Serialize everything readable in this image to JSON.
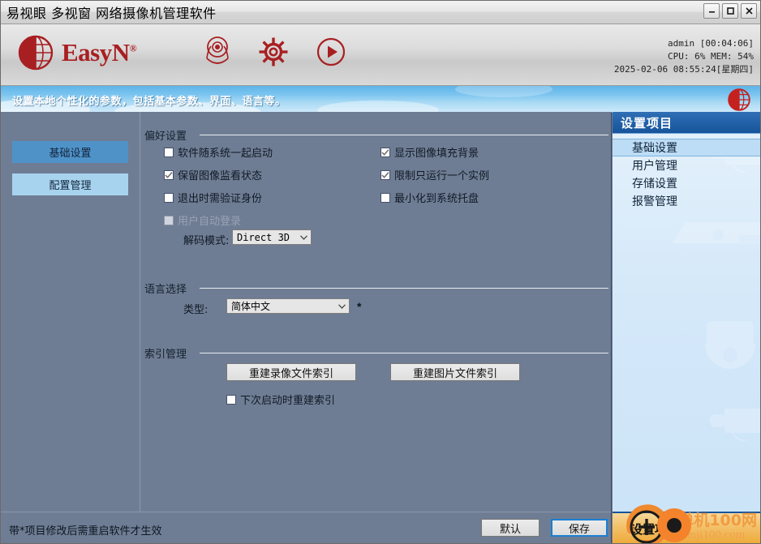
{
  "window": {
    "title": "易视眼 多视窗 网络摄像机管理软件",
    "controls": {
      "minimize": "minimize-button",
      "maximize": "maximize-button",
      "close": "close-button"
    }
  },
  "header": {
    "brand": "EasyN",
    "brand_mark": "®",
    "icons": [
      "camera-icon",
      "gear-icon",
      "play-icon"
    ],
    "status": {
      "user_line": "admin [00:04:06]",
      "resource_line": "CPU:  6%  MEM: 54%",
      "datetime_line": "2025-02-06 08:55:24[星期四]"
    }
  },
  "banner": {
    "text": "设置本地个性化的参数，包括基本参数、界面、语言等。"
  },
  "nav": {
    "items": [
      {
        "label": "基础设置",
        "active": true
      },
      {
        "label": "配置管理",
        "active": false
      }
    ]
  },
  "preferences": {
    "group_title": "偏好设置",
    "left_items": [
      {
        "label": "软件随系统一起启动",
        "checked": false,
        "disabled": false
      },
      {
        "label": "保留图像监看状态",
        "checked": true,
        "disabled": false
      },
      {
        "label": "退出时需验证身份",
        "checked": false,
        "disabled": false
      },
      {
        "label": "用户自动登录",
        "checked": false,
        "disabled": true
      }
    ],
    "right_items": [
      {
        "label": "显示图像填充背景",
        "checked": true,
        "disabled": false
      },
      {
        "label": "限制只运行一个实例",
        "checked": true,
        "disabled": false
      },
      {
        "label": "最小化到系统托盘",
        "checked": false,
        "disabled": false
      }
    ],
    "decode_label": "解码模式:",
    "decode_value": "Direct 3D"
  },
  "language": {
    "group_title": "语言选择",
    "type_label": "类型:",
    "type_value": "简体中文",
    "restart_marker": "*"
  },
  "index": {
    "group_title": "索引管理",
    "rebuild_video_label": "重建录像文件索引",
    "rebuild_image_label": "重建图片文件索引",
    "rebuild_next_start": {
      "label": "下次启动时重建索引",
      "checked": false
    }
  },
  "footer": {
    "note": "带*项目修改后需重启软件才生效",
    "default_button": "默认",
    "save_button": "保存"
  },
  "sidebar": {
    "title": "设置项目",
    "items": [
      {
        "label": "基础设置",
        "selected": true
      },
      {
        "label": "用户管理",
        "selected": false
      },
      {
        "label": "存储设置",
        "selected": false
      },
      {
        "label": "报警管理",
        "selected": false
      }
    ],
    "footer_label": "设置项目"
  },
  "watermark": {
    "cn": "单机100网",
    "en": "danji100.com"
  },
  "colors": {
    "panel_bg": "#6f7d94",
    "nav_active": "#4f92c8",
    "nav_idle": "#a8d3ef",
    "brand_red": "#a81f22",
    "sidebar_header": "#17549b",
    "sidebar_bg": "#cbe3f8",
    "footer_orange": "#eeab3c",
    "focus_blue": "#1a7fd4"
  }
}
